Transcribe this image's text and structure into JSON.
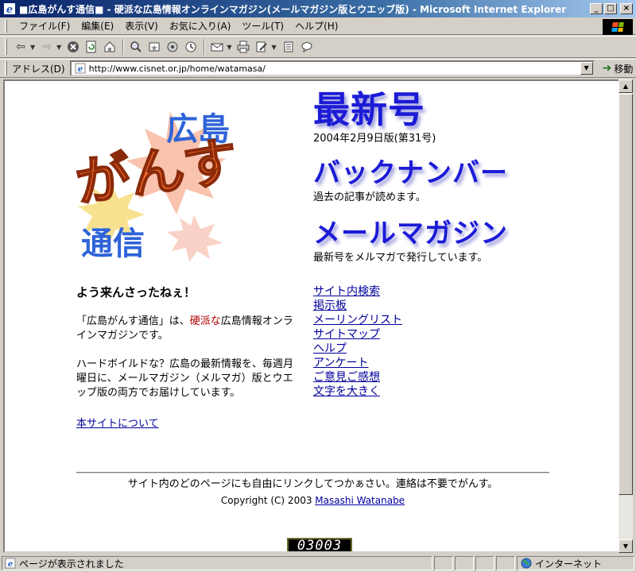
{
  "window": {
    "title": "■広島がんす通信■ ‐ 硬派な広島情報オンラインマガジン(メールマガジン版とウエッブ版) - Microsoft Internet Explorer",
    "minimize": "_",
    "maximize": "□",
    "close": "×"
  },
  "menubar": {
    "items": [
      "ファイル(F)",
      "編集(E)",
      "表示(V)",
      "お気に入り(A)",
      "ツール(T)",
      "ヘルプ(H)"
    ]
  },
  "toolbar": {
    "buttons": [
      "back-icon",
      "forward-icon",
      "stop-icon",
      "refresh-icon",
      "home-icon",
      "search-icon",
      "favorites-icon",
      "media-icon",
      "history-icon",
      "mail-icon",
      "print-icon",
      "edit-icon",
      "discuss-icon",
      "messenger-icon"
    ]
  },
  "addressbar": {
    "label": "アドレス(D)",
    "url": "http://www.cisnet.or.jp/home/watamasa/",
    "go_label": "移動"
  },
  "page": {
    "logo": {
      "place_text": "広島",
      "main_text": "がんす",
      "tsushin_text": "通信"
    },
    "welcome": "よう来んさったねぇ！",
    "intro_pre": "「広島がんす通信」は、",
    "intro_accent": "硬派な",
    "intro_post": "広島情報オンラインマガジンです。",
    "description": "ハードボイルドな？広島の最新情報を、毎週月曜日に、メールマガジン（メルマガ）版とウエッブ版の両方でお届けしています。",
    "about_link": "本サイトについて",
    "sections": [
      {
        "heading": "最新号",
        "sub": "2004年2月9日版(第31号)"
      },
      {
        "heading": "バックナンバー",
        "sub": "過去の記事が読めます。"
      },
      {
        "heading": "メールマガジン",
        "sub": "最新号をメルマガで発行しています。"
      }
    ],
    "links": [
      "サイト内検索",
      "掲示板",
      "メーリングリスト",
      "サイトマップ",
      "ヘルプ",
      "アンケート",
      "ご意見ご感想",
      "文字を大きく"
    ],
    "footer_notice": "サイト内のどのページにも自由にリンクしてつかぁさい。連絡は不要でがんす。",
    "copyright_prefix": "Copyright (C) 2003 ",
    "author": "Masashi Watanabe",
    "counter": "03003"
  },
  "statusbar": {
    "text": "ページが表示されました",
    "zone": "インターネット"
  },
  "colors": {
    "heading_blue": "#1b1bd6",
    "accent_red": "#b00000",
    "logo_orange": "#f26a2c",
    "logo_blue": "#2f64d8",
    "link": "#00009c"
  }
}
